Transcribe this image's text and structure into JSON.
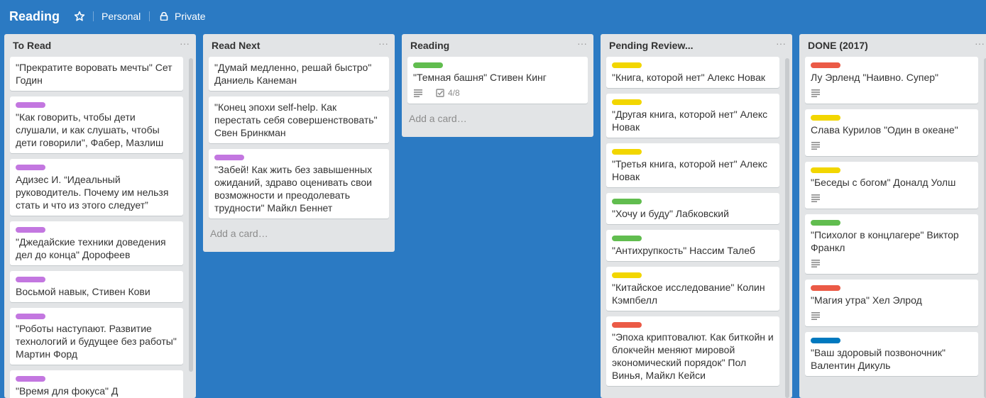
{
  "header": {
    "title": "Reading",
    "star_icon": "star-outline-icon",
    "team": "Personal",
    "visibility": "Private",
    "visibility_icon": "lock-icon"
  },
  "lists": [
    {
      "title": "To Read",
      "menu": "···",
      "cards": [
        {
          "label": "",
          "text": "\"Прекратите воровать мечты\" Сет Годин"
        },
        {
          "label": "#c377e0",
          "text": "\"Как говорить, чтобы дети слушали, и как слушать, чтобы дети говорили\", Фабер, Мазлиш"
        },
        {
          "label": "#c377e0",
          "text": "Адизес И. “Идеальный руководитель. Почему им нельзя стать и что из этого следует”"
        },
        {
          "label": "#c377e0",
          "text": "\"Джедайские техники доведения дел до конца\" Дорофеев"
        },
        {
          "label": "#c377e0",
          "text": "Восьмой навык, Стивен Кови"
        },
        {
          "label": "#c377e0",
          "text": "\"Роботы наступают. Развитие технологий и будущее без работы\" Мартин Форд"
        },
        {
          "label": "#c377e0",
          "text": "\"Время для фокуса\" Д"
        }
      ]
    },
    {
      "title": "Read Next",
      "menu": "···",
      "cards": [
        {
          "label": "",
          "text": "\"Думай медленно, решай быстро\" Даниель Канеман"
        },
        {
          "label": "",
          "text": "\"Конец эпохи self-help. Как перестать себя совершенствовать\" Свен Бринкман"
        },
        {
          "label": "#c377e0",
          "text": "\"Забей! Как жить без завышенных ожиданий, здраво оценивать свои возможности и преодолевать трудности\" Майкл Беннет"
        }
      ],
      "add_card": "Add a card…"
    },
    {
      "title": "Reading",
      "menu": "···",
      "cards": [
        {
          "label": "#61bd4f",
          "text": "\"Темная башня\" Стивен Кинг",
          "description_icon": "description-icon",
          "checklist_icon": "checklist-icon",
          "checklist": "4/8"
        }
      ],
      "add_card": "Add a card…"
    },
    {
      "title": "Pending Review...",
      "menu": "···",
      "cards": [
        {
          "label": "#f2d600",
          "text": "\"Книга, которой нет\" Алекс Новак"
        },
        {
          "label": "#f2d600",
          "text": "\"Другая книга, которой нет\" Алекс Новак"
        },
        {
          "label": "#f2d600",
          "text": "\"Третья книга, которой нет\" Алекс Новак"
        },
        {
          "label": "#61bd4f",
          "text": "\"Хочу и буду\" Лабковский"
        },
        {
          "label": "#61bd4f",
          "text": "\"Антихрупкость\" Нассим Талеб"
        },
        {
          "label": "#f2d600",
          "text": "\"Китайское исследование\" Колин Кэмпбелл"
        },
        {
          "label": "#eb5a46",
          "text": "\"Эпоха криптовалют. Как биткойн и блокчейн меняют мировой экономический порядок\" Пол Винья, Майкл Кейси"
        }
      ]
    },
    {
      "title": "DONE (2017)",
      "menu": "···",
      "cards": [
        {
          "label": "#eb5a46",
          "text": "Лу Эрленд \"Наивно. Супер\"",
          "description_icon": "description-icon"
        },
        {
          "label": "#f2d600",
          "text": "Слава Курилов \"Один в океане\"",
          "description_icon": "description-icon"
        },
        {
          "label": "#f2d600",
          "text": "\"Беседы с богом\" Доналд Уолш",
          "description_icon": "description-icon"
        },
        {
          "label": "#61bd4f",
          "text": "\"Психолог в концлагере\" Виктор Франкл",
          "description_icon": "description-icon"
        },
        {
          "label": "#eb5a46",
          "text": "\"Магия утра\" Хел Элрод",
          "description_icon": "description-icon"
        },
        {
          "label": "#0079bf",
          "text": "\"Ваш здоровый позвоночник\" Валентин Дикуль"
        }
      ]
    }
  ]
}
